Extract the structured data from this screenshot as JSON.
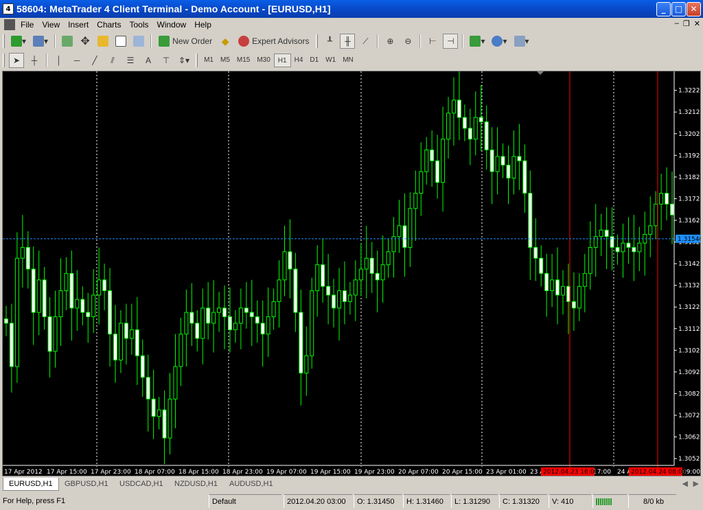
{
  "window": {
    "title": "58604: MetaTrader 4 Client Terminal - Demo Account - [EURUSD,H1]",
    "app_icon": "4"
  },
  "menu": [
    "File",
    "View",
    "Insert",
    "Charts",
    "Tools",
    "Window",
    "Help"
  ],
  "toolbar1": {
    "new_order": "New Order",
    "expert_advisors": "Expert Advisors"
  },
  "timeframes": [
    "M1",
    "M5",
    "M15",
    "M30",
    "H1",
    "H4",
    "D1",
    "W1",
    "MN"
  ],
  "active_timeframe": "H1",
  "chart_data": {
    "type": "candlestick",
    "symbol": "EURUSD",
    "timeframe": "H1",
    "ylim": [
      1.305,
      1.323
    ],
    "price_ticks": [
      "1.32225",
      "1.32125",
      "1.32025",
      "1.31925",
      "1.31825",
      "1.31725",
      "1.31625",
      "1.31525",
      "1.31425",
      "1.31325",
      "1.31225",
      "1.31125",
      "1.31025",
      "1.30925",
      "1.30825",
      "1.30725",
      "1.30625",
      "1.30525"
    ],
    "time_labels": [
      "17 Apr 2012",
      "17 Apr 15:00",
      "17 Apr 23:00",
      "18 Apr 07:00",
      "18 Apr 15:00",
      "18 Apr 23:00",
      "19 Apr 07:00",
      "19 Apr 15:00",
      "19 Apr 23:00",
      "20 Apr 07:00",
      "20 Apr 15:00",
      "23 Apr 01:00",
      "23 A",
      "17:00",
      "24 A",
      "09:00"
    ],
    "current_price": "1.31540",
    "marker_labels": [
      "2012.04.23 16:00",
      "2012.04.24 08:00"
    ],
    "colors": {
      "bull": "#00ff00",
      "bear": "#ffffff",
      "grid": "#ffffff",
      "ask_line": "#1e90ff",
      "marker": "#ff0000",
      "price_label": "#1e90ff"
    },
    "closes": [
      1.3115,
      1.3095,
      1.3145,
      1.315,
      1.314,
      1.312,
      1.3135,
      1.3118,
      1.3102,
      1.3118,
      1.313,
      1.3138,
      1.3122,
      1.3126,
      1.312,
      1.3118,
      1.3128,
      1.3135,
      1.313,
      1.311,
      1.3098,
      1.3115,
      1.3108,
      1.3112,
      1.31,
      1.309,
      1.308,
      1.3072,
      1.3075,
      1.3062,
      1.308,
      1.3095,
      1.311,
      1.312,
      1.3115,
      1.3108,
      1.3122,
      1.3115,
      1.312,
      1.3122,
      1.3118,
      1.3112,
      1.3115,
      1.3122,
      1.312,
      1.3118,
      1.3115,
      1.311,
      1.3118,
      1.3125,
      1.3135,
      1.3148,
      1.314,
      1.312,
      1.3092,
      1.31,
      1.313,
      1.3142,
      1.3132,
      1.3128,
      1.3122,
      1.313,
      1.3125,
      1.3128,
      1.3135,
      1.314,
      1.3145,
      1.3138,
      1.3135,
      1.3142,
      1.3148,
      1.3155,
      1.316,
      1.315,
      1.3168,
      1.3175,
      1.3185,
      1.3195,
      1.319,
      1.318,
      1.32,
      1.3212,
      1.3218,
      1.321,
      1.3205,
      1.32,
      1.321,
      1.3208,
      1.3195,
      1.3185,
      1.3192,
      1.3188,
      1.3182,
      1.3192,
      1.319,
      1.3175,
      1.315,
      1.3145,
      1.3138,
      1.313,
      1.3135,
      1.3128,
      1.3132,
      1.3125,
      1.3122,
      1.3132,
      1.3138,
      1.315,
      1.3155,
      1.3158,
      1.3155,
      1.315,
      1.3148,
      1.3152,
      1.315,
      1.3148,
      1.3152,
      1.3156,
      1.316,
      1.317,
      1.3175,
      1.317,
      1.3165
    ],
    "wicks": [
      1.3025,
      1.3045
    ]
  },
  "tabs": [
    "EURUSD,H1",
    "GBPUSD,H1",
    "USDCAD,H1",
    "NZDUSD,H1",
    "AUDUSD,H1"
  ],
  "active_tab": "EURUSD,H1",
  "status": {
    "help": "For Help, press F1",
    "profile": "Default",
    "time": "2012.04.20 03:00",
    "open": "O: 1.31450",
    "high": "H: 1.31460",
    "low": "L: 1.31290",
    "close": "C: 1.31320",
    "volume": "V: 410",
    "traffic": "8/0 kb"
  }
}
